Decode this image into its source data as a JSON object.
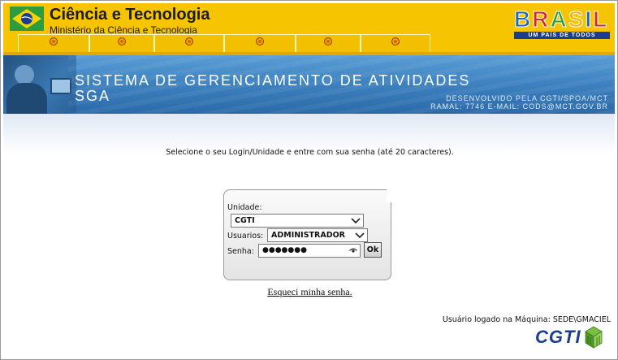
{
  "header": {
    "ministry_title": "Ciência e Tecnologia",
    "ministry_subtitle": "Ministério da Ciência e Tecnologia",
    "nav_tabs": 6,
    "brasil_word": [
      "B",
      "R",
      "A",
      "S",
      "I",
      "L"
    ],
    "brasil_colors": [
      "#1a6bb3",
      "#d62828",
      "#2e9c3d",
      "#f4b400",
      "#1a6bb3",
      "#d62828"
    ],
    "brasil_slogan": "UM PAÍS DE TODOS"
  },
  "banner": {
    "system_title": "SISTEMA DE GERENCIAMENTO DE ATIVIDADES",
    "system_abbr": "SGA",
    "developed_by": "DESENVOLVIDO PELA CGTI/SPOA/MCT",
    "contact": "RAMAL: 7746 E-MAIL: CODS@MCT.GOV.BR"
  },
  "instruction": "Selecione o seu Login/Unidade e entre com sua senha (até 20 caracteres).",
  "login": {
    "unidade_label": "Unidade:",
    "unidade_value": "CGTI",
    "usuarios_label": "Usuarios:",
    "usuarios_value": "ADMINISTRADOR",
    "senha_label": "Senha:",
    "senha_value": "●●●●●●●",
    "ok_label": "Ok"
  },
  "forgot_password": "Esqueci minha senha.",
  "user_logged": "Usuário logado na Máquina: SEDE\\GMACIEL",
  "footer_logo": "CGTI",
  "colors": {
    "header_yellow": "#f6c400",
    "banner_blue": "#3f83c2",
    "logo_blue": "#1c3f8c"
  }
}
